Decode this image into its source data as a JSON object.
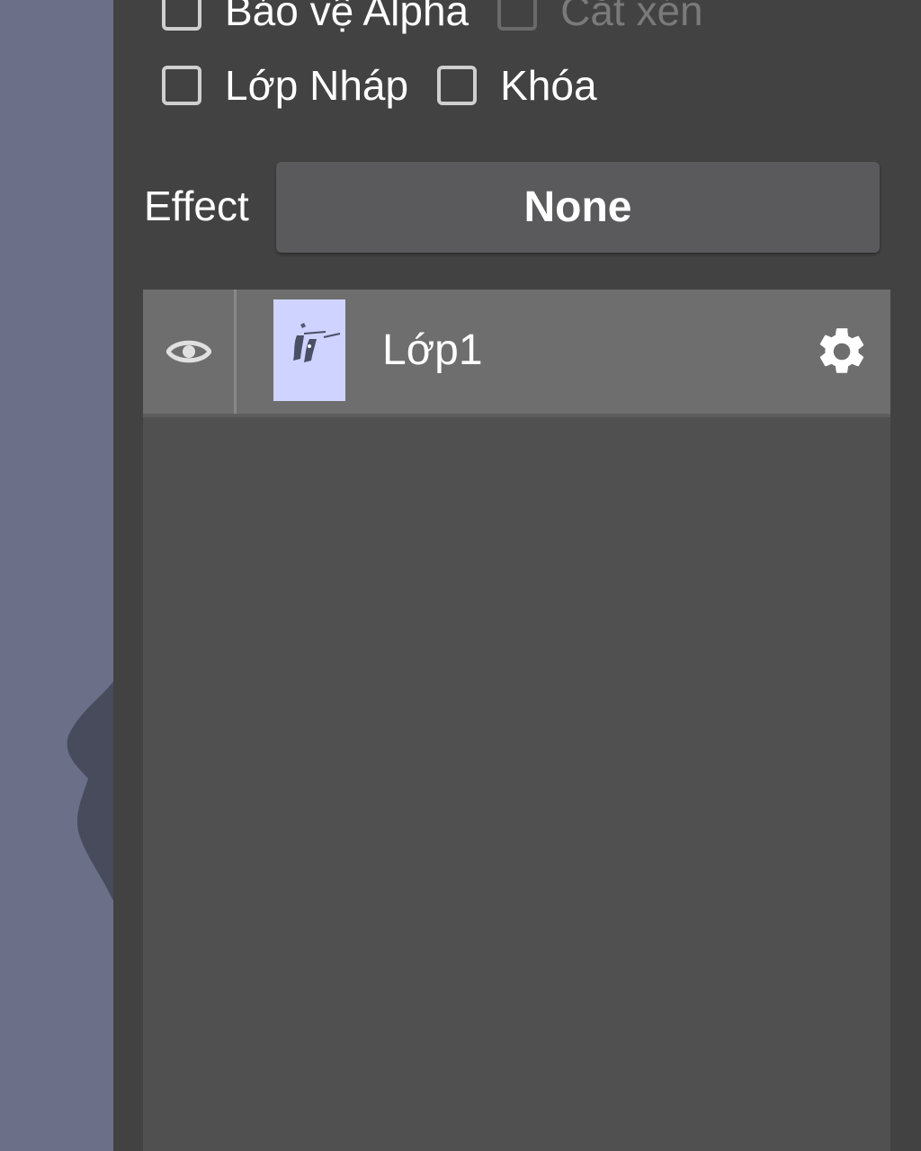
{
  "options": {
    "row1": [
      {
        "label": "Bảo vệ Alpha",
        "checked": false,
        "disabled": false
      },
      {
        "label": "Cắt xén",
        "checked": false,
        "disabled": true
      }
    ],
    "row2": [
      {
        "label": "Lớp Nháp",
        "checked": false,
        "disabled": false
      },
      {
        "label": "Khóa",
        "checked": false,
        "disabled": false
      }
    ]
  },
  "effect": {
    "label": "Effect",
    "value": "None"
  },
  "layers": [
    {
      "name": "Lớp1",
      "visible": true,
      "icons": [
        "eye-icon",
        "gear-icon"
      ]
    }
  ],
  "colors": {
    "panel_bg": "#424242",
    "canvas_bg": "#6b6f87",
    "selected_layer": "#6e6e6e",
    "thumbnail_bg": "#cfd3ff"
  }
}
